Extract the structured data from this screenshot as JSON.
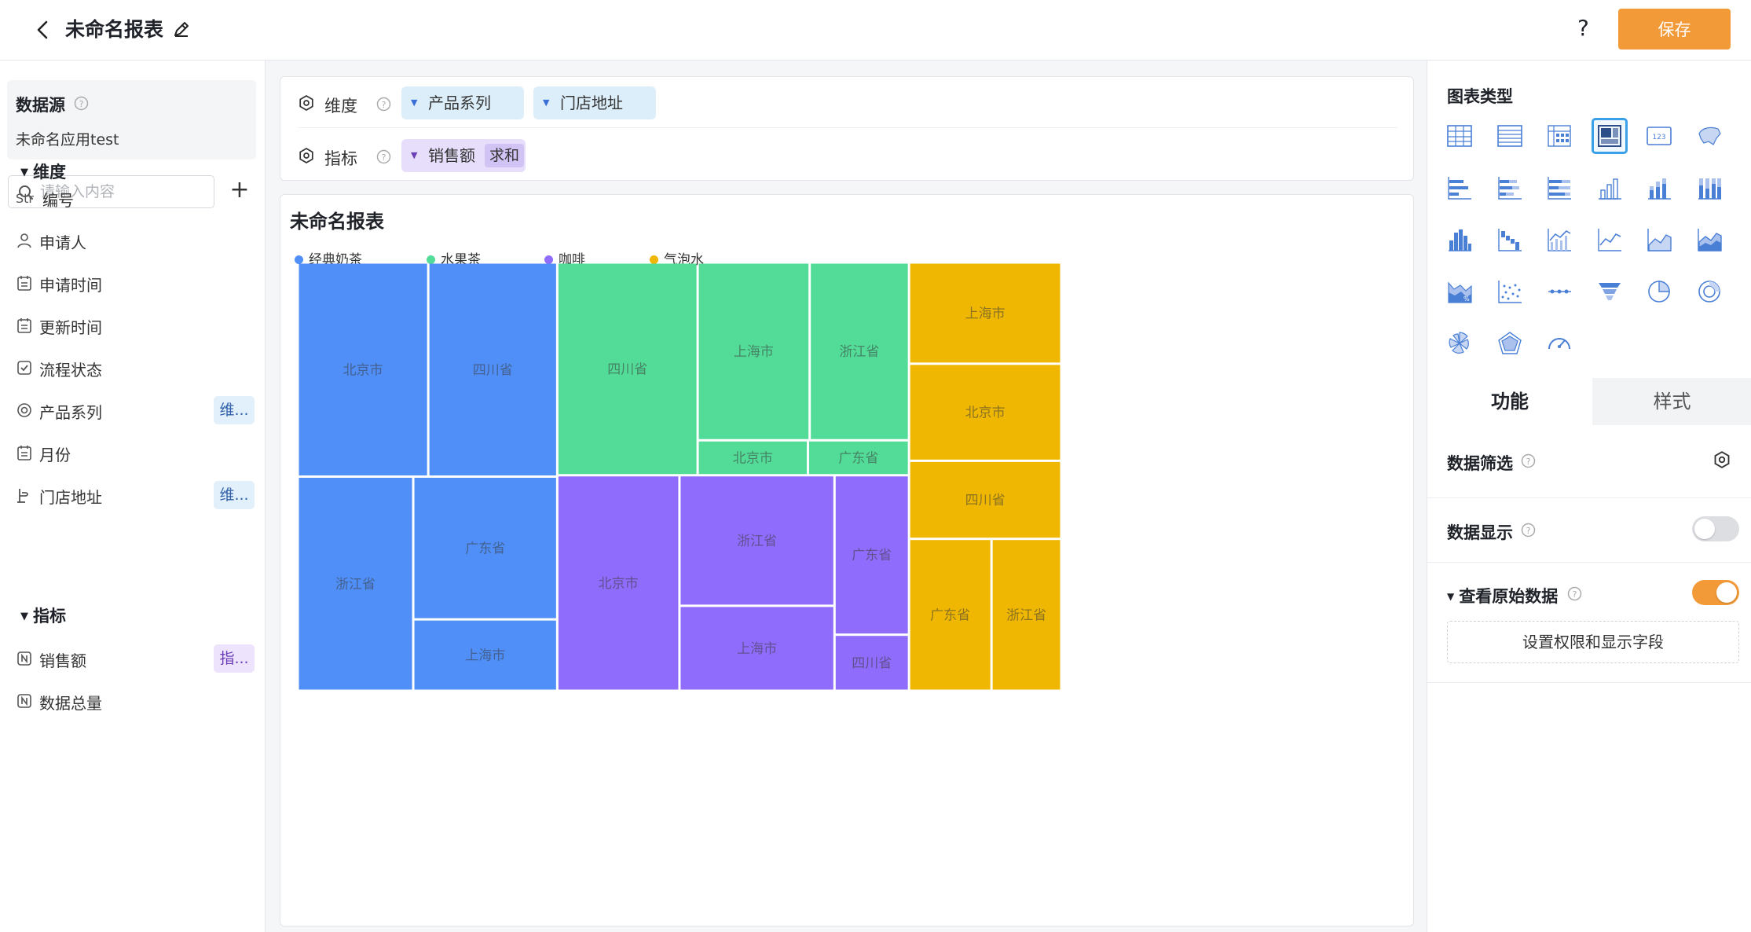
{
  "header": {
    "title": "未命名报表",
    "help_label": "?",
    "save_label": "保存"
  },
  "sidebar": {
    "datasource_title": "数据源",
    "datasource_name": "未命名应用test",
    "search_placeholder": "请输入内容",
    "add_label": "+",
    "dimension_group": "维度",
    "metric_group": "指标",
    "dimensions": [
      {
        "icon": "Str",
        "label": "编号",
        "tag": ""
      },
      {
        "icon": "person-icon",
        "label": "申请人",
        "tag": ""
      },
      {
        "icon": "calendar-icon",
        "label": "申请时间",
        "tag": ""
      },
      {
        "icon": "calendar-icon",
        "label": "更新时间",
        "tag": ""
      },
      {
        "icon": "checkbox-icon",
        "label": "流程状态",
        "tag": ""
      },
      {
        "icon": "radio-icon",
        "label": "产品系列",
        "tag": "维..."
      },
      {
        "icon": "calendar-icon",
        "label": "月份",
        "tag": ""
      },
      {
        "icon": "location-icon",
        "label": "门店地址",
        "tag": "维..."
      }
    ],
    "metrics": [
      {
        "icon": "number-icon",
        "label": "销售额",
        "tag": "指..."
      },
      {
        "icon": "number-icon",
        "label": "数据总量",
        "tag": ""
      }
    ]
  },
  "config": {
    "dimension_label": "维度",
    "metric_label": "指标",
    "dimension_chips": [
      "产品系列",
      "门店地址"
    ],
    "metric_chip": "销售额",
    "metric_agg": "求和"
  },
  "chart_data": {
    "type": "treemap",
    "title": "未命名报表",
    "legend": [
      "经典奶茶",
      "水果茶",
      "咖啡",
      "气泡水"
    ],
    "colors": {
      "经典奶茶": "#4f8ff7",
      "水果茶": "#52dc98",
      "咖啡": "#8f6cfb",
      "气泡水": "#efb701"
    },
    "series": [
      {
        "name": "经典奶茶",
        "children": [
          {
            "name": "北京市",
            "value": 87
          },
          {
            "name": "四川省",
            "value": 86
          },
          {
            "name": "浙江省",
            "value": 77
          },
          {
            "name": "广东省",
            "value": 64
          },
          {
            "name": "上海市",
            "value": 32
          }
        ]
      },
      {
        "name": "水果茶",
        "children": [
          {
            "name": "四川省",
            "value": 93
          },
          {
            "name": "上海市",
            "value": 62
          },
          {
            "name": "浙江省",
            "value": 55
          },
          {
            "name": "北京市",
            "value": 12
          },
          {
            "name": "广东省",
            "value": 11
          }
        ]
      },
      {
        "name": "咖啡",
        "children": [
          {
            "name": "北京市",
            "value": 82
          },
          {
            "name": "浙江省",
            "value": 63
          },
          {
            "name": "上海市",
            "value": 41
          },
          {
            "name": "广东省",
            "value": 37
          },
          {
            "name": "四川省",
            "value": 13
          }
        ]
      },
      {
        "name": "气泡水",
        "children": [
          {
            "name": "上海市",
            "value": 48
          },
          {
            "name": "北京市",
            "value": 46
          },
          {
            "name": "四川省",
            "value": 37
          },
          {
            "name": "广东省",
            "value": 39
          },
          {
            "name": "浙江省",
            "value": 33
          }
        ]
      }
    ]
  },
  "right_panel": {
    "chart_type_title": "图表类型",
    "selected_chart_type": "treemap",
    "chart_types": [
      "table",
      "detail-table",
      "pivot-table",
      "treemap",
      "kpi-card",
      "map",
      "bar-h",
      "bar-h-stacked",
      "bar-h-percent",
      "column",
      "column-stacked",
      "column-percent",
      "histogram",
      "waterfall",
      "combo",
      "line",
      "area",
      "stacked-area",
      "percent-area",
      "scatter",
      "dot-line",
      "funnel",
      "pie",
      "donut",
      "nightingale",
      "radar",
      "gauge"
    ],
    "tab_function": "功能",
    "tab_style": "样式",
    "data_filter_label": "数据筛选",
    "data_display_label": "数据显示",
    "data_display_on": false,
    "raw_data_label": "查看原始数据",
    "raw_data_on": true,
    "permission_button": "设置权限和显示字段"
  }
}
